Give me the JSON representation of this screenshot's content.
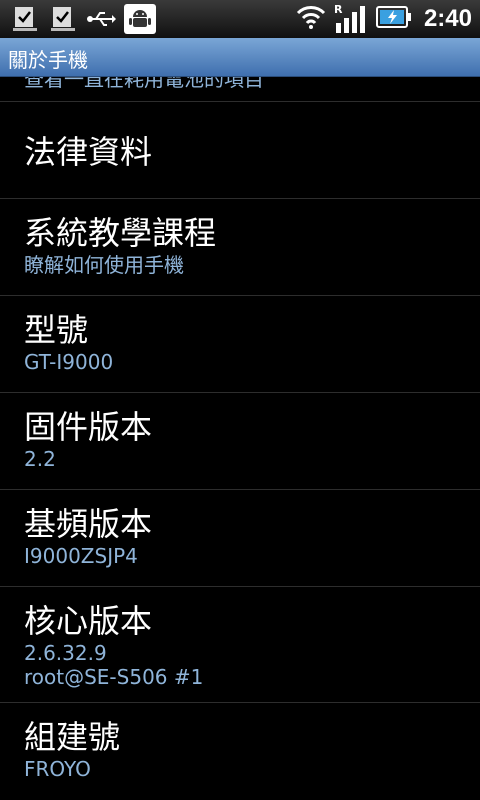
{
  "status_bar": {
    "time": "2:40",
    "roaming_label": "R",
    "icons": [
      "download-check-icon",
      "download-check-icon",
      "usb-icon",
      "android-debug-icon",
      "wifi-icon",
      "signal-icon",
      "battery-charging-icon"
    ]
  },
  "title_bar": {
    "title": "關於手機"
  },
  "partial_item": {
    "summary": "查看一直在耗用電池的項目"
  },
  "items": [
    {
      "title": "法律資料",
      "summary": ""
    },
    {
      "title": "系統教學課程",
      "summary": "瞭解如何使用手機"
    },
    {
      "title": "型號",
      "summary": "GT-I9000"
    },
    {
      "title": "固件版本",
      "summary": "2.2"
    },
    {
      "title": "基頻版本",
      "summary": "I9000ZSJP4"
    },
    {
      "title": "核心版本",
      "summary_line1": "2.6.32.9",
      "summary_line2": "root@SE-S506 #1"
    },
    {
      "title": "組建號",
      "summary": "FROYO"
    }
  ],
  "colors": {
    "title_bar_bg": "#5b8cc6",
    "summary_text": "#8fb4d9",
    "background": "#000000"
  }
}
